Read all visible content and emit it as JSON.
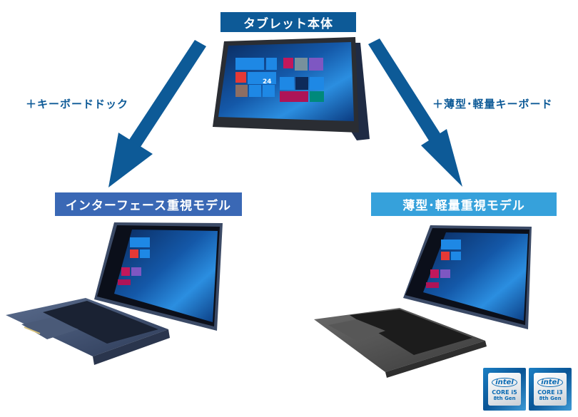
{
  "diagram": {
    "top": {
      "label": "タブレット本体",
      "image": "tablet-with-kickstand"
    },
    "branches": [
      {
        "addon_label": "＋キーボードドック",
        "model_label": "インターフェース重視モデル",
        "image": "tablet-with-keyboard-dock",
        "color": "#3A68B5"
      },
      {
        "addon_label": "＋薄型･軽量キーボード",
        "model_label": "薄型･軽量重視モデル",
        "image": "tablet-with-slim-keyboard",
        "color": "#36A1DB"
      }
    ],
    "arrow_color": "#0D5A97",
    "top_color": "#0D5A97"
  },
  "badges": [
    {
      "logo": "intel",
      "line1": "CORE i5",
      "line2": "8th Gen"
    },
    {
      "logo": "intel",
      "line1": "CORE i3",
      "line2": "8th Gen"
    }
  ],
  "screen": {
    "tile_date": "24"
  }
}
